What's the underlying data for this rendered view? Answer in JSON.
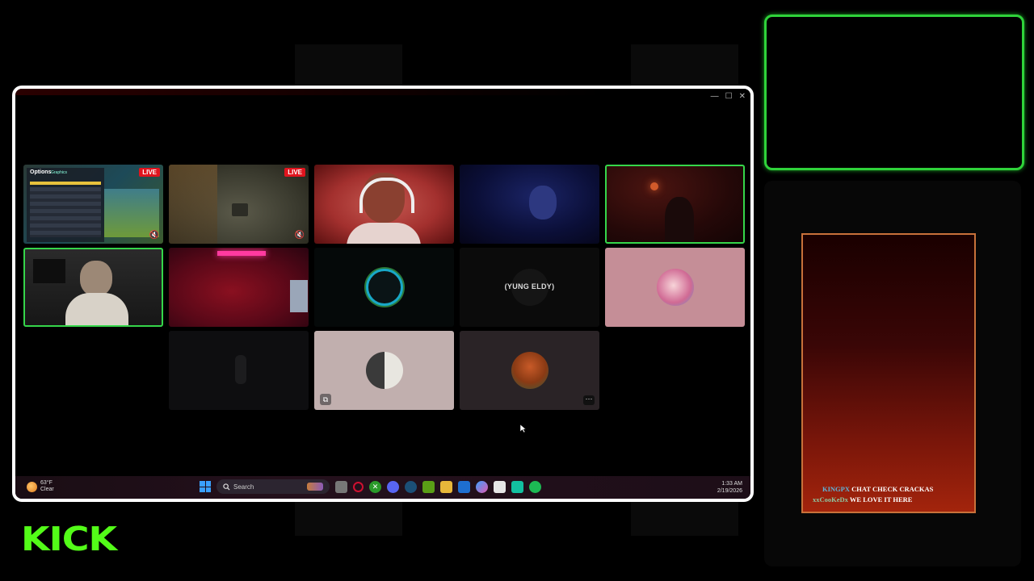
{
  "window": {
    "controls": [
      "—",
      "☐",
      "✕"
    ]
  },
  "tiles": [
    {
      "id": "t1",
      "live_badge": "LIVE",
      "overlay_title": "Options",
      "overlay_subtitle": "Graphics"
    },
    {
      "id": "t2",
      "live_badge": "LIVE"
    },
    {
      "id": "t3"
    },
    {
      "id": "t4"
    },
    {
      "id": "t5",
      "active": true
    },
    {
      "id": "t6",
      "active": true
    },
    {
      "id": "t7"
    },
    {
      "id": "t8",
      "name": "(YUNG ELDY)"
    },
    {
      "id": "t9"
    },
    {
      "id": "t10"
    },
    {
      "id": "t11"
    },
    {
      "id": "t12",
      "more": "···"
    }
  ],
  "taskbar": {
    "weather_temp": "63°F",
    "weather_desc": "Clear",
    "search_placeholder": "Search",
    "time": "1:33 AM",
    "date": "2/19/2026"
  },
  "chat": {
    "messages": [
      {
        "user": "KINGPX",
        "text": "CHAT CHECK CRACKAS"
      },
      {
        "user": "xxCooKeDx",
        "text": "WE LOVE IT HERE"
      }
    ]
  },
  "brand": {
    "logo_text": "KICK",
    "accent_color": "#53fc18"
  }
}
